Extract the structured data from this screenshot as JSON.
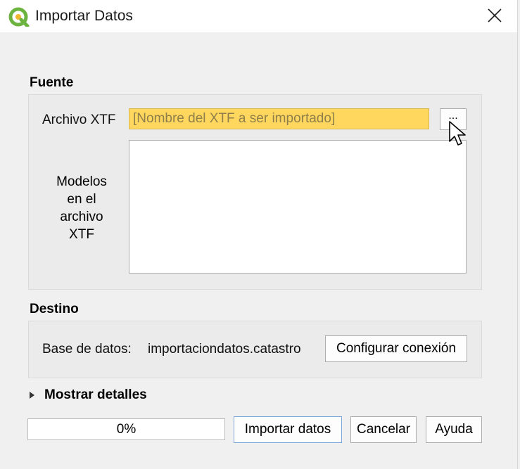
{
  "window": {
    "title": "Importar Datos",
    "icon": "qgis-logo-icon",
    "close_icon": "close-icon"
  },
  "source": {
    "section_title": "Fuente",
    "xtf_label": "Archivo XTF",
    "xtf_value": "",
    "xtf_placeholder": "[Nombre del XTF a ser importado]",
    "browse_label": "...",
    "models_label_lines": [
      "Modelos",
      "en el",
      "archivo",
      "XTF"
    ],
    "models_items": []
  },
  "destination": {
    "section_title": "Destino",
    "db_label": "Base de datos:",
    "db_value": "importaciondatos.catastro",
    "configure_button": "Configurar conexión"
  },
  "details": {
    "label": "Mostrar detalles",
    "expanded": false
  },
  "footer": {
    "progress_text": "0%",
    "progress_value": 0,
    "import_button": "Importar datos",
    "cancel_button": "Cancelar",
    "help_button": "Ayuda"
  },
  "colors": {
    "input_highlight": "#ffd75e",
    "window_bg": "#f0f0f0",
    "titlebar_bg": "#ffffff",
    "default_button_border": "#7fa8d8",
    "qgis_green": "#6cb33f",
    "qgis_yellow": "#f1b62b"
  }
}
